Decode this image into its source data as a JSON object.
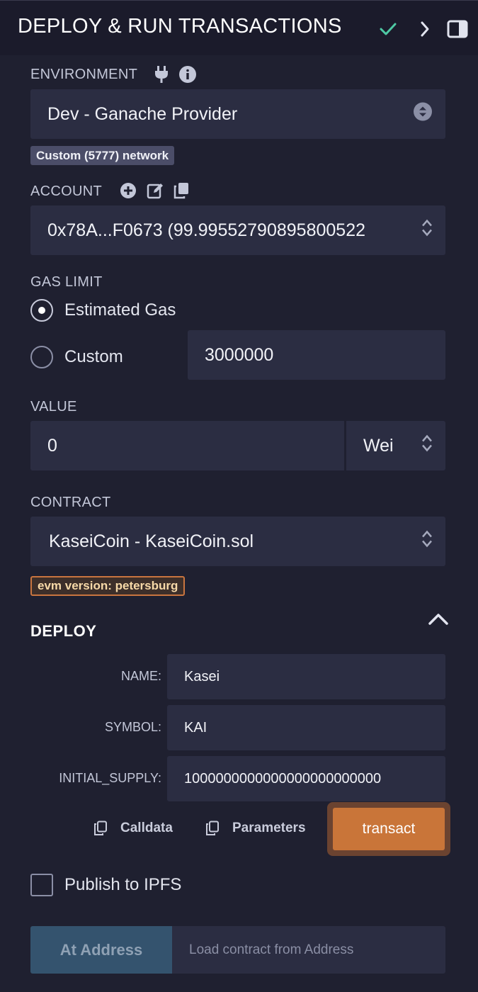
{
  "header": {
    "title": "DEPLOY & RUN TRANSACTIONS"
  },
  "environment": {
    "label": "ENVIRONMENT",
    "value": "Dev - Ganache Provider",
    "network_badge": "Custom (5777) network"
  },
  "account": {
    "label": "ACCOUNT",
    "value": "0x78A...F0673 (99.99552790895800522"
  },
  "gas_limit": {
    "label": "GAS LIMIT",
    "options": [
      {
        "label": "Estimated Gas",
        "checked": true
      },
      {
        "label": "Custom",
        "checked": false
      }
    ],
    "custom_value": "3000000"
  },
  "value": {
    "label": "VALUE",
    "amount": "0",
    "unit": "Wei"
  },
  "contract": {
    "label": "CONTRACT",
    "value": "KaseiCoin - KaseiCoin.sol",
    "evm_badge": "evm version: petersburg"
  },
  "deploy": {
    "title": "DEPLOY",
    "params": [
      {
        "label": "NAME:",
        "value": "Kasei"
      },
      {
        "label": "SYMBOL:",
        "value": "KAI"
      },
      {
        "label": "INITIAL_SUPPLY:",
        "value": "1000000000000000000000000"
      }
    ],
    "calldata_label": "Calldata",
    "parameters_label": "Parameters",
    "transact_label": "transact"
  },
  "publish": {
    "label": "Publish to IPFS",
    "checked": false
  },
  "at_address": {
    "button_label": "At Address",
    "placeholder": "Load contract from Address"
  },
  "colors": {
    "background": "#1f2030",
    "field": "#2b2d42",
    "accent_check": "#4ec9a4",
    "transact": "#c97539",
    "at_address": "#34536e"
  }
}
